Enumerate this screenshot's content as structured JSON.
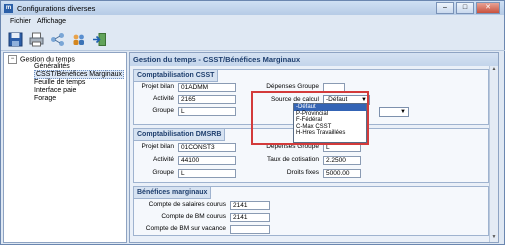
{
  "window": {
    "title": "Configurations diverses",
    "app_icon_letter": "m"
  },
  "menu": [
    "Fichier",
    "Affichage"
  ],
  "toolbar": [
    "save-icon",
    "print-icon",
    "network-icon",
    "users-icon",
    "exit-icon"
  ],
  "tree": {
    "root": "Gestion du temps",
    "children": [
      "Généralités",
      "CSST/Bénéfices Marginaux",
      "Feuille de temps",
      "Interface paie"
    ],
    "sibling": "Forage"
  },
  "panel": {
    "title": "Gestion du temps - CSST/Bénéfices Marginaux",
    "csst": {
      "title": "Comptabilisation CSST",
      "projet_bilan_label": "Projet bilan",
      "projet_bilan": "01ADMM",
      "activite_label": "Activité",
      "activite": "2165",
      "groupe_label": "Groupe",
      "groupe": "L",
      "depenses_groupe_label": "Dépenses Groupe",
      "depenses_groupe": "",
      "source_calcul_label": "Source de calcul",
      "source_calcul": "-Défaut",
      "options": [
        "-Défaut",
        "P-Provincial",
        "F-Fédéral",
        "C-Max CSST",
        "H-Hres Travaillées"
      ]
    },
    "dmsrb": {
      "title": "Comptabilisation DMSRB",
      "projet_bilan_label": "Projet bilan",
      "projet_bilan": "01CONST3",
      "activite_label": "Activité",
      "activite": "44100",
      "groupe_label": "Groupe",
      "groupe": "L",
      "depenses_groupe_label": "Dépenses Groupe",
      "depenses_groupe": "L",
      "taux_label": "Taux de cotisation",
      "taux": "2.2500",
      "droits_label": "Droits fixes",
      "droits": "5000.00"
    },
    "benefices": {
      "title": "Bénéfices marginaux",
      "salaires_label": "Compte de salaires courus",
      "salaires": "2141",
      "bm_label": "Compte de BM courus",
      "bm": "2141",
      "bm_vacance_label": "Compte de BM sur vacance",
      "bm_vacance": ""
    }
  }
}
